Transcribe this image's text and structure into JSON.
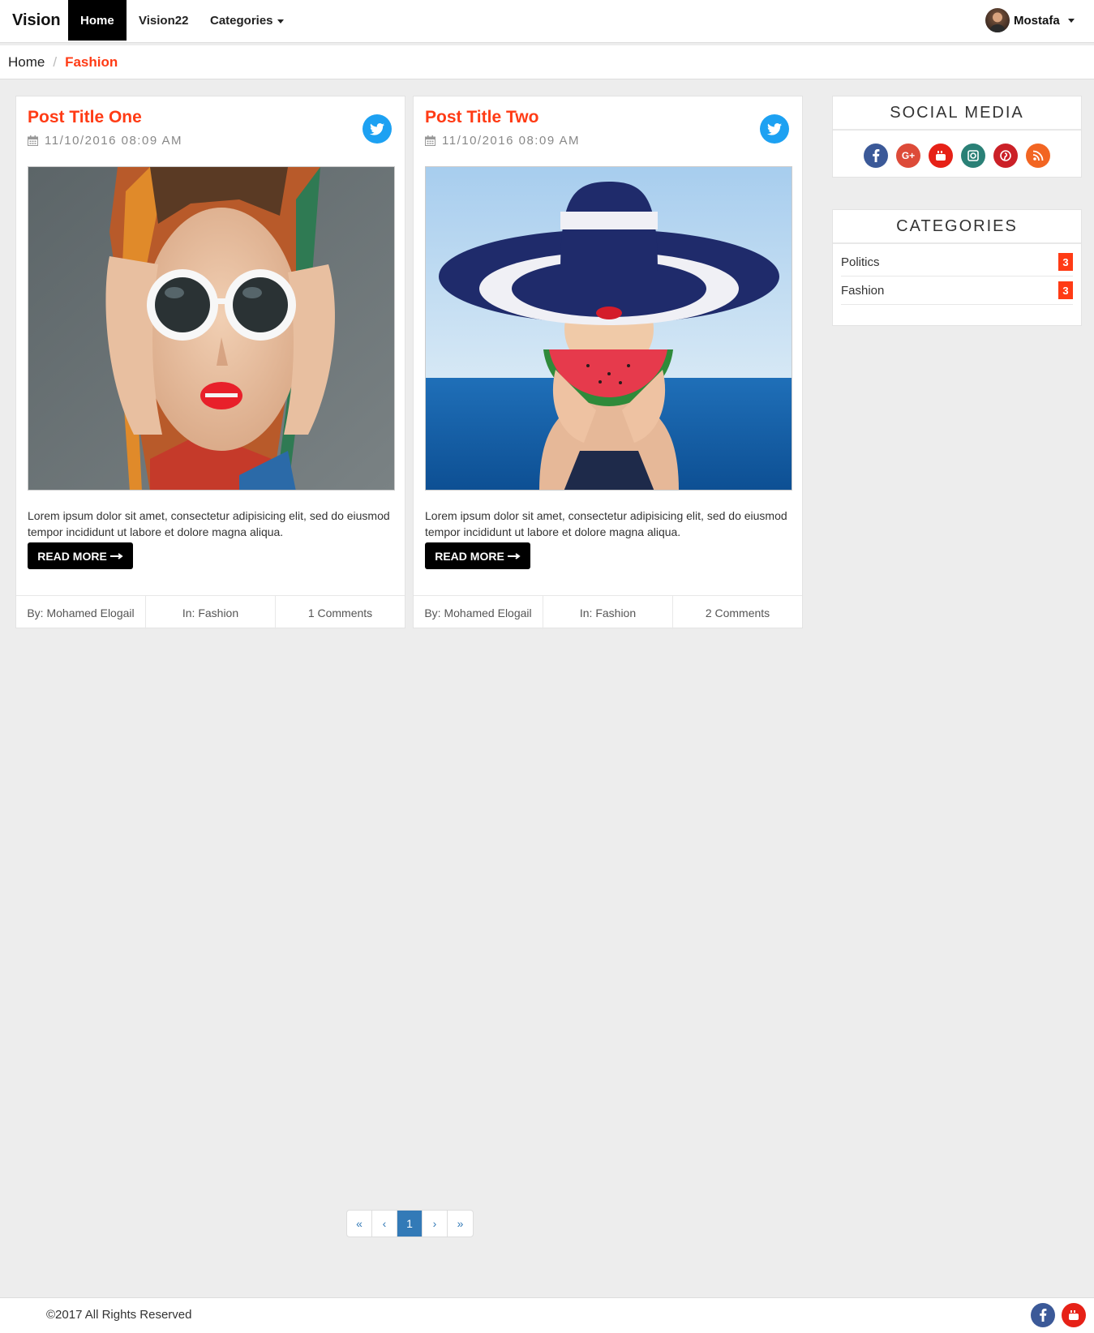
{
  "navbar": {
    "brand": "Vision",
    "links": [
      "Home",
      "Vision22",
      "Categories"
    ],
    "user_name": "Mostafa"
  },
  "breadcrumb": {
    "home": "Home",
    "separator": "/",
    "current": "Fashion"
  },
  "posts": [
    {
      "title": "Post Title One",
      "date": "11/10/2016 08:09 AM",
      "excerpt": "Lorem ipsum dolor sit amet, consectetur adipisicing elit, sed do eiusmod tempor incididunt ut labore et dolore magna aliqua.",
      "read_more": "READ MORE",
      "author": "By: Mohamed Elogail",
      "category": "In: Fashion",
      "comments": "1 Comments"
    },
    {
      "title": "Post Title Two",
      "date": "11/10/2016 08:09 AM",
      "excerpt": "Lorem ipsum dolor sit amet, consectetur adipisicing elit, sed do eiusmod tempor incididunt ut labore et dolore magna aliqua.",
      "read_more": "READ MORE",
      "author": "By: Mohamed Elogail",
      "category": "In: Fashion",
      "comments": "2 Comments"
    }
  ],
  "sidebar": {
    "social_title": "SOCIAL MEDIA",
    "social_icons": [
      {
        "name": "facebook-icon",
        "color": "#3b5998"
      },
      {
        "name": "google-plus-icon",
        "color": "#dd4b39"
      },
      {
        "name": "youtube-icon",
        "color": "#e62117"
      },
      {
        "name": "instagram-icon",
        "color": "#2a8076"
      },
      {
        "name": "pinterest-icon",
        "color": "#cb2027"
      },
      {
        "name": "rss-icon",
        "color": "#f26522"
      }
    ],
    "categories_title": "CATEGORIES",
    "categories": [
      {
        "label": "Politics",
        "count": "3"
      },
      {
        "label": "Fashion",
        "count": "3"
      }
    ]
  },
  "pagination": {
    "first": "«",
    "prev": "‹",
    "current": "1",
    "next": "›",
    "last": "»"
  },
  "footer": {
    "copyright": "©2017 All Rights Reserved"
  },
  "colors": {
    "accent": "#ff3b15",
    "twitter": "#1da1f2",
    "link": "#337ab7"
  }
}
